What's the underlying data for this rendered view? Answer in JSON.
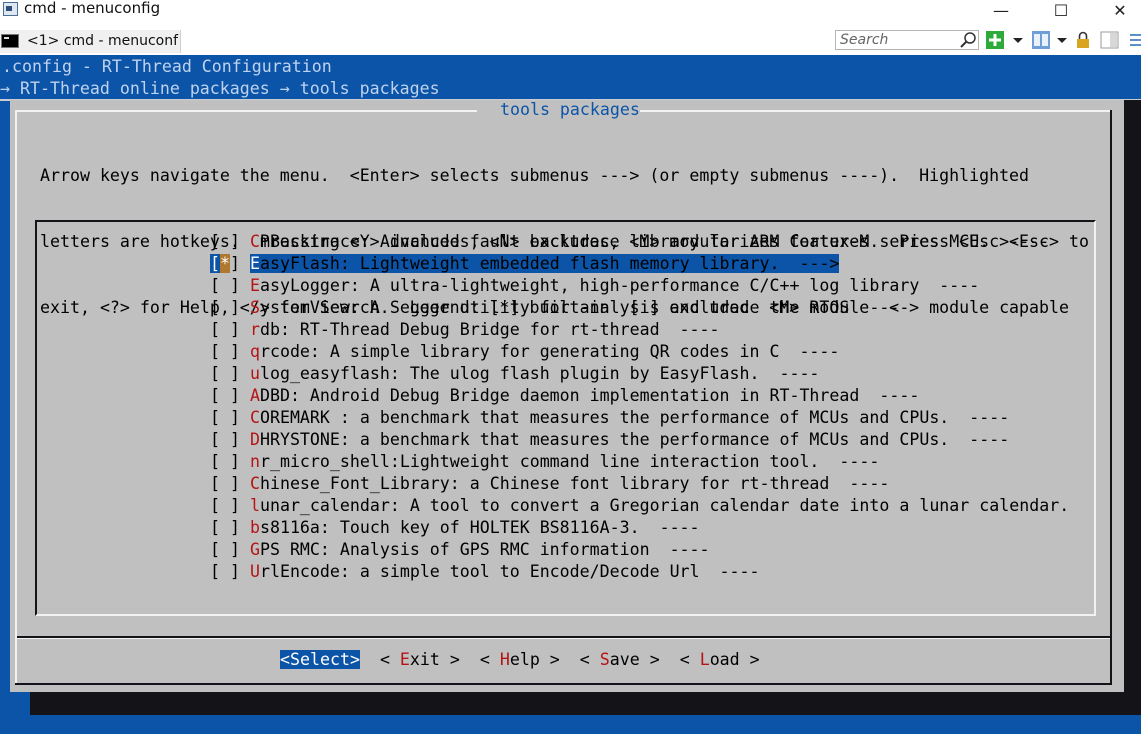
{
  "window": {
    "title": "cmd - menuconfig",
    "minimize_glyph": "—",
    "maximize_glyph": "☐",
    "close_glyph": "✕"
  },
  "tabbar": {
    "tab_label": "<1> cmd - menuconf",
    "search_placeholder": "Search",
    "tool_icons": [
      "search-icon",
      "new-console-icon",
      "dropdown-icon",
      "panes-icon",
      "dropdown-icon",
      "lock-icon",
      "toolbar-split-icon",
      "menu-icon"
    ]
  },
  "terminal": {
    "breadcrumb_config": ".config - RT-Thread Configuration",
    "breadcrumb_path": "→ RT-Thread online packages → tools packages"
  },
  "dialog": {
    "title": " tools packages ",
    "help_lines": [
      "Arrow keys navigate the menu.  <Enter> selects submenus ---> (or empty submenus ----).  Highlighted",
      "letters are hotkeys.  Pressing <Y> includes, <N> excludes, <M> modularizes features.  Press <Esc><Esc> to",
      "exit, <?> for Help, </> for Search.  Legend: [*] built-in  [ ] excluded  <M> module  < > module capable"
    ],
    "items": [
      {
        "check": "[ ] ",
        "hotkey": "C",
        "rest": "mBacktrace: Advanced fault backtrace library for ARM Cortex-M series MCU.  ----",
        "selected": false
      },
      {
        "check": "[*] ",
        "hotkey": "E",
        "rest": "asyFlash: Lightweight embedded flash memory library.  --->",
        "selected": true
      },
      {
        "check": "[ ] ",
        "hotkey": "E",
        "rest": "asyLogger: A ultra-lightweight, high-performance C/C++ log library  ----",
        "selected": false
      },
      {
        "check": "[ ] ",
        "hotkey": "S",
        "rest": "ystemView: A Segger utility for analysis and trace the RTOS  ----",
        "selected": false
      },
      {
        "check": "[ ] ",
        "hotkey": "r",
        "rest": "db: RT-Thread Debug Bridge for rt-thread  ----",
        "selected": false
      },
      {
        "check": "[ ] ",
        "hotkey": "q",
        "rest": "rcode: A simple library for generating QR codes in C  ----",
        "selected": false
      },
      {
        "check": "[ ] ",
        "hotkey": "u",
        "rest": "log_easyflash: The ulog flash plugin by EasyFlash.  ----",
        "selected": false
      },
      {
        "check": "[ ] ",
        "hotkey": "A",
        "rest": "DBD: Android Debug Bridge daemon implementation in RT-Thread  ----",
        "selected": false
      },
      {
        "check": "[ ] ",
        "hotkey": "C",
        "rest": "OREMARK : a benchmark that measures the performance of MCUs and CPUs.  ----",
        "selected": false
      },
      {
        "check": "[ ] ",
        "hotkey": "D",
        "rest": "HRYSTONE: a benchmark that measures the performance of MCUs and CPUs.  ----",
        "selected": false
      },
      {
        "check": "[ ] ",
        "hotkey": "n",
        "rest": "r_micro_shell:Lightweight command line interaction tool.  ----",
        "selected": false
      },
      {
        "check": "[ ] ",
        "hotkey": "C",
        "rest": "hinese_Font_Library: a Chinese font library for rt-thread  ----",
        "selected": false
      },
      {
        "check": "[ ] ",
        "hotkey": "l",
        "rest": "unar_calendar: A tool to convert a Gregorian calendar date into a lunar calendar.",
        "selected": false
      },
      {
        "check": "[ ] ",
        "hotkey": "b",
        "rest": "s8116a: Touch key of HOLTEK BS8116A-3.  ----",
        "selected": false
      },
      {
        "check": "[ ] ",
        "hotkey": "G",
        "rest": "PS RMC: Analysis of GPS RMC information  ----",
        "selected": false
      },
      {
        "check": "[ ] ",
        "hotkey": "U",
        "rest": "rlEncode: a simple tool to Encode/Decode Url  ----",
        "selected": false
      }
    ],
    "buttons": [
      {
        "pre": "<",
        "hotkey": "S",
        "rest": "elect>",
        "selected": true
      },
      {
        "pre": "< ",
        "hotkey": "E",
        "rest": "xit >",
        "selected": false
      },
      {
        "pre": "< ",
        "hotkey": "H",
        "rest": "elp >",
        "selected": false
      },
      {
        "pre": "< ",
        "hotkey": "S",
        "rest": "ave >",
        "selected": false
      },
      {
        "pre": "< ",
        "hotkey": "L",
        "rest": "oad >",
        "selected": false
      }
    ]
  },
  "colors": {
    "terminal_bg": "#0b54a8",
    "dialog_bg": "#c0c0c0",
    "hotkey": "#b61414",
    "highlight_bg": "#0b54a8"
  }
}
